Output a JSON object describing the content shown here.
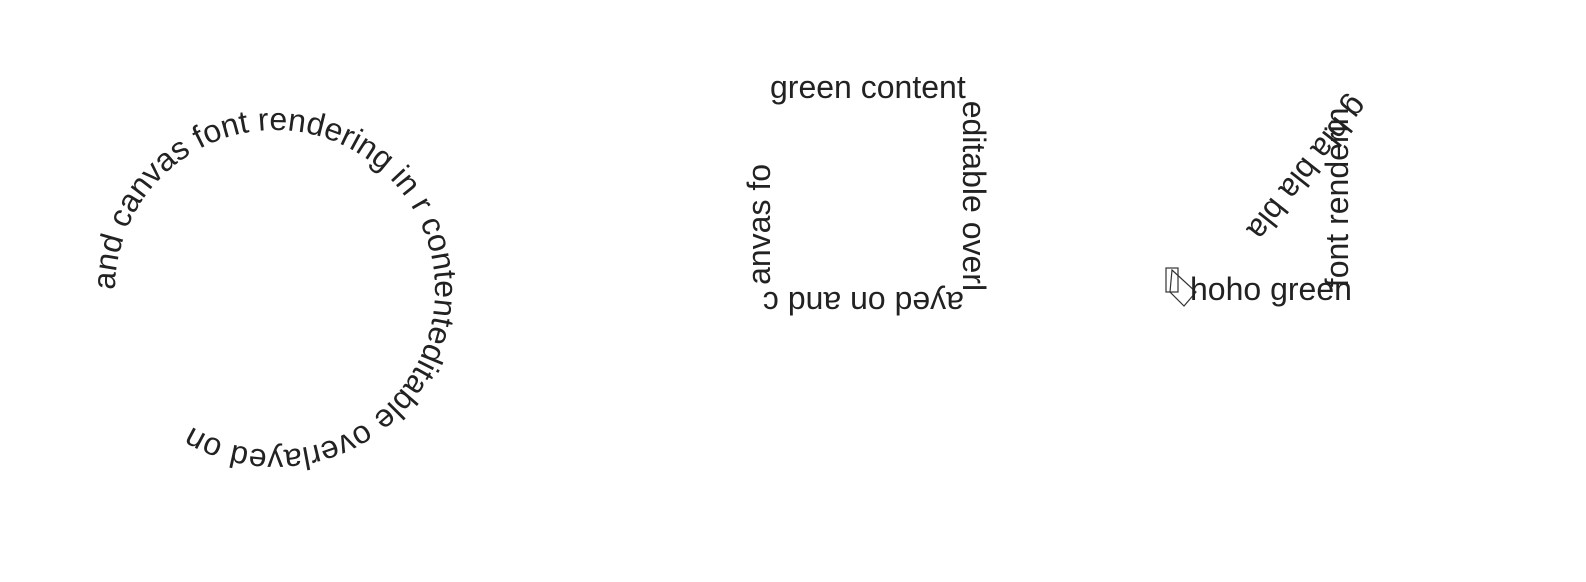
{
  "colors": {
    "background": "#ffffff",
    "text": "#222222"
  },
  "shapes": {
    "circle": {
      "text": "and canvas font rendering in r                    contenteditable overlayed on "
    },
    "square": {
      "text": "green contenteditable overlayed on and canvas fo"
    },
    "triangle": {
      "glyph": "[",
      "text": "hoho green font rendering bla bla bla "
    }
  }
}
